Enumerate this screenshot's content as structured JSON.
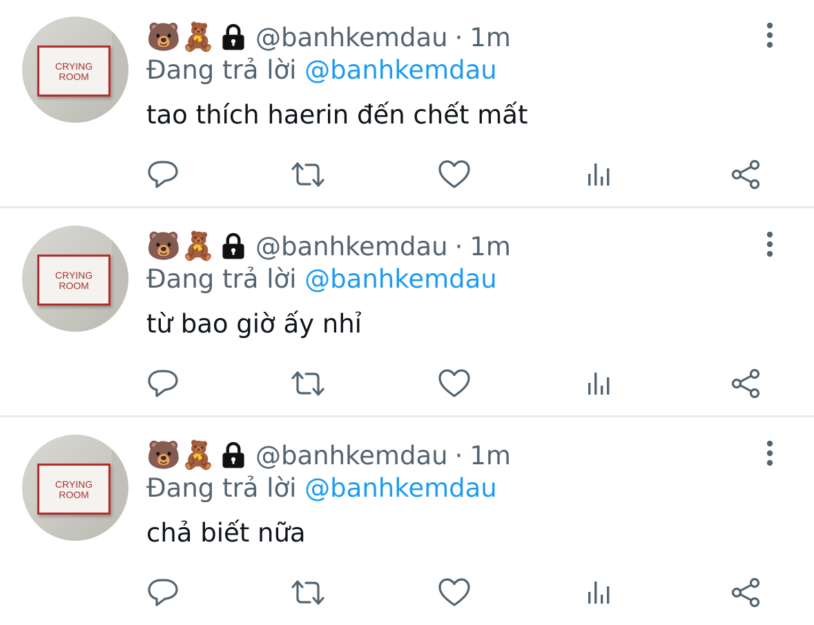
{
  "tweets": [
    {
      "avatar_text_line1": "CRYING",
      "avatar_text_line2": "ROOM",
      "emoji1": "🐻",
      "emoji2": "🧸",
      "handle": "@banhkemdau",
      "separator": "·",
      "time": "1m",
      "reply_prefix": "Đang trả lời",
      "reply_to": "@banhkemdau",
      "text": "tao thích haerin đến chết mất"
    },
    {
      "avatar_text_line1": "CRYING",
      "avatar_text_line2": "ROOM",
      "emoji1": "🐻",
      "emoji2": "🧸",
      "handle": "@banhkemdau",
      "separator": "·",
      "time": "1m",
      "reply_prefix": "Đang trả lời",
      "reply_to": "@banhkemdau",
      "text": "từ bao giờ ấy nhỉ"
    },
    {
      "avatar_text_line1": "CRYING",
      "avatar_text_line2": "ROOM",
      "emoji1": "🐻",
      "emoji2": "🧸",
      "handle": "@banhkemdau",
      "separator": "·",
      "time": "1m",
      "reply_prefix": "Đang trả lời",
      "reply_to": "@banhkemdau",
      "text": "chả biết nữa"
    }
  ],
  "icons": {
    "protected": "lock-icon",
    "more": "more-vertical-icon",
    "reply": "reply-icon",
    "retweet": "retweet-icon",
    "like": "heart-icon",
    "views": "views-icon",
    "share": "share-icon"
  },
  "colors": {
    "text_primary": "#0f1419",
    "text_secondary": "#536471",
    "mention": "#1d9bf0",
    "icon": "#536471",
    "divider": "#e8ecef",
    "sign_red": "#b42b2b"
  }
}
